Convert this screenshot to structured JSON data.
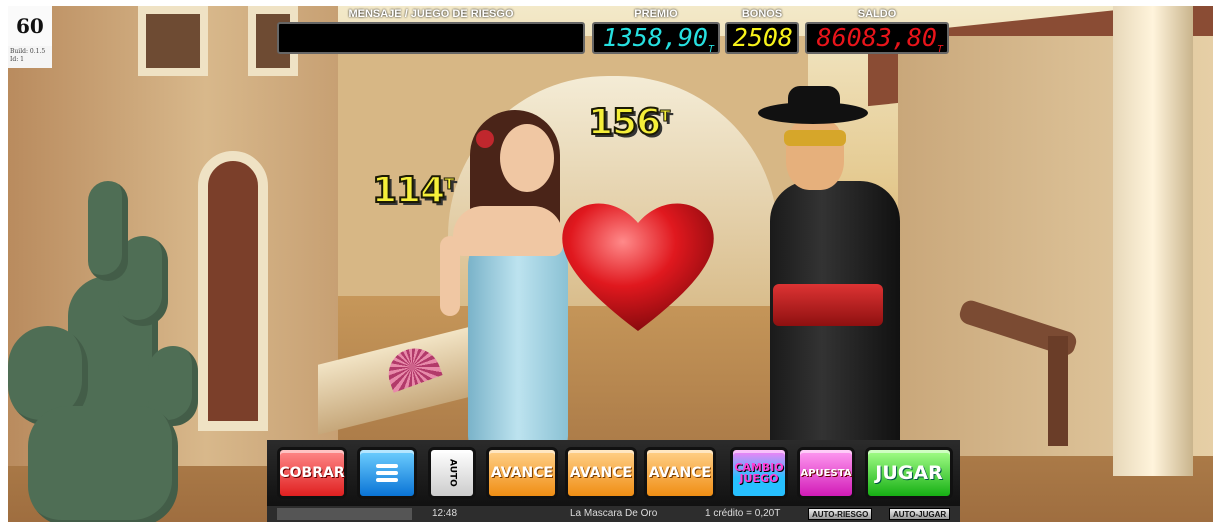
{
  "fps_counter": "60",
  "build_info": {
    "build": "Build: 0.1.5",
    "id": "Id: 1"
  },
  "hud": {
    "message_label": "MENSAJE / JUEGO DE RIESGO",
    "message_value": "",
    "premio_label": "PREMIO",
    "premio_value": "1358,90",
    "premio_unit": "T",
    "premio_color": "#27e0e0",
    "bonos_label": "BONOS",
    "bonos_value": "2508",
    "bonos_color": "#f6f21a",
    "saldo_label": "SALDO",
    "saldo_value": "86083,80",
    "saldo_unit": "T",
    "saldo_color": "#e8141a"
  },
  "scene": {
    "left_prize_value": "114",
    "left_prize_unit": "T",
    "right_prize_value": "156",
    "right_prize_unit": "T"
  },
  "buttons": {
    "cobrar": "COBRAR",
    "auto": "AUTO",
    "avance_1": "AVANCE",
    "avance_2": "AVANCE",
    "avance_3": "AVANCE",
    "cambio_juego": "CAMBIO JUEGO",
    "apuesta": "APUESTA",
    "jugar": "JUGAR"
  },
  "status_bar": {
    "time": "12:48",
    "game_name": "La Mascara De Oro",
    "credit": "1 crédito = 0,20T",
    "auto_riesgo": "AUTO-RIESGO",
    "auto_jugar": "AUTO-JUGAR"
  }
}
